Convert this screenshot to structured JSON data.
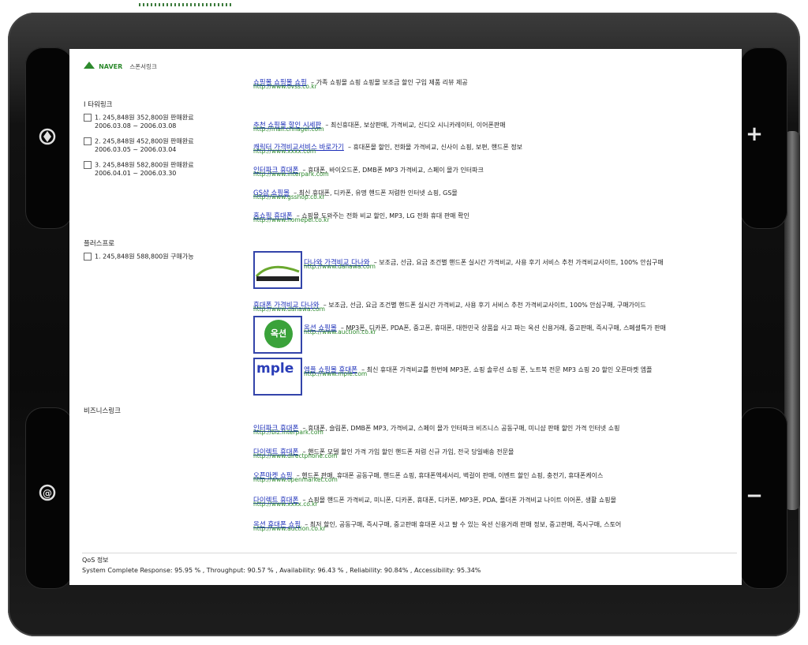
{
  "device": {
    "plus_label": "+",
    "minus_label": "−",
    "top_icon": "settings-rotate-icon",
    "bottom_icon": "refresh-icon"
  },
  "header": {
    "logo_text": "NAVER",
    "sponsor_label": "스폰서링크"
  },
  "top_ad": {
    "title": "쇼핑몰 쇼핑몰 쇼핑",
    "desc": "– 가족 쇼핑몰 쇼핑 쇼핑몰 보조금 할인 구입 제품 리뷰 제공",
    "url": "http://www.ovss.co.kr"
  },
  "sidebar": {
    "sections": [
      {
        "title": "Ⅰ 타워링크",
        "items": [
          {
            "line1": "1. 245,848원 352,800원 판매완료",
            "line2": "2006.03.08 ~ 2006.03.08"
          },
          {
            "line1": "2. 245,848원 452,800원 판매완료",
            "line2": "2006.03.05 ~ 2006.03.04"
          },
          {
            "line1": "3. 245,848원 582,800원 판매완료",
            "line2": "2006.04.01 ~ 2006.03.30"
          }
        ]
      },
      {
        "title": "플러스프로",
        "items": [
          {
            "line1": "1. 245,848원 588,800원 구매가능",
            "line2": ""
          }
        ]
      },
      {
        "title": "비즈니스링크",
        "items": []
      }
    ]
  },
  "ads_group1": [
    {
      "title": "추천 쇼핑몰 할인 시세판",
      "desc": "– 최신휴대폰, 보상판매, 가격비교, 신디오 시니카레이터, 이어폰판매",
      "url": "http://mall.chnagel.com"
    },
    {
      "title": "캐릭터 가격비교서비스 바로가기",
      "desc": "– 휴대폰몰 할인, 전화몰 가격비교, 신사이 쇼핑, 보편, 핸드폰 정보",
      "url": "http://www.xxxx.com"
    },
    {
      "title": "인터파크 휴대폰",
      "desc": "– 휴대폰, 바이오드폰, DMB폰 MP3 가격비교, 스페이 몰가 인터파크",
      "url": "http://www.interpark.com"
    },
    {
      "title": "GS샵 쇼핑몰",
      "desc": "– 최신 휴대폰, 디카폰, 유명 핸드폰 저렴한 인터넷 쇼핑, GS몰",
      "url": "http://www.gsshop.co.kr"
    },
    {
      "title": "홈쇼핑 휴대폰",
      "desc": "– 쇼핑몰 도와주는 전화 비교 할인, MP3, LG 전화 휴대 판매 확인",
      "url": "http://www.homepel.co.kr"
    }
  ],
  "ads_group2": [
    {
      "thumb": "danawa",
      "thumb_text": "",
      "title": "다나와 가격비교 다나와",
      "desc": "– 보조금, 선금, 요금 조건별 핸드폰 실시간 가격비교, 사용 후기 서비스 추천 가격비교사이트, 100% 안심구매",
      "url": "http://www.danawa.com"
    },
    {
      "thumb": "",
      "thumb_text": "",
      "title": "휴대폰 가격비교 다나와",
      "desc": "– 보조금, 선금, 요금 조건별 핸드폰 실시간 가격비교, 사용 후기 서비스 추천 가격비교사이트, 100% 안심구매, 구매가이드",
      "url": "http://www.danawa.com"
    },
    {
      "thumb": "auction",
      "thumb_text": "옥션",
      "title": "옥션 쇼핑몰",
      "desc": "– MP3폰, 디카폰, PDA폰, 중고폰, 휴대폰, 대한민국 상품을 사고 파는 옥션 신용거래, 중고판매, 즉시구매, 스페셜특가 판매",
      "url": "http://www.auction.co.kr"
    },
    {
      "thumb": "mple",
      "thumb_text": "mple",
      "title": "엠플 쇼핑몰 휴대폰",
      "desc": "– 최신 휴대폰 가격비교를 한번에 MP3폰, 쇼핑 솔루션 쇼핑 폰, 노트북 전문 MP3 쇼핑 20 할인 오픈마켓 엠플",
      "url": "http://www.mple.com"
    }
  ],
  "ads_group3": [
    {
      "title": "인터파크 휴대폰",
      "desc": "– 휴대폰, 슬림폰, DMB폰 MP3, 가격비교, 스페이 몰가 인터파크 비즈니스 공동구매, 미니샵 판매 할인 가격 인터넷 쇼핑",
      "url": "http://biz.interpark.com"
    },
    {
      "title": "다이렉트 휴대폰",
      "desc": "– 핸드폰 모델 할인 가격 가입 할인 핸드폰 저렴 신규 가입, 전국 당일배송 전문몰",
      "url": "http://www.directphone.com"
    },
    {
      "title": "오픈마켓 쇼핑",
      "desc": "– 핸드폰 판매, 휴대폰 공동구매, 핸드폰 쇼핑, 휴대폰액세서리, 벽걸이 판매, 이벤트 할인 쇼핑, 충전기, 휴대폰케이스",
      "url": "http://www.openmarket.com"
    },
    {
      "title": "다이렉트 휴대폰",
      "desc": "– 쇼핑몰 핸드폰 가격비교, 미니폰, 디카폰, 휴대폰, 디카폰, MP3폰, PDA, 폴더폰 가격비교 나이트 이어폰, 생활 쇼핑몰",
      "url": "http://www.xxxx.co.kr"
    },
    {
      "title": "옥션 휴대폰 쇼핑",
      "desc": "– 최저 할인, 공동구매, 즉시구매, 중고판매 휴대폰 사고 팔 수 있는 옥션 신용거래 판매 정보, 중고판매, 즉시구매, 스토어",
      "url": "http://www.auction.co.kr"
    }
  ],
  "qos": {
    "title": "QoS 정보",
    "line": "System Complete Response: 95.95 % ,  Throughput: 90.57 % ,  Availability: 96.43 % ,  Reliability: 90.84% ,  Accessibility: 95.34%"
  },
  "colors": {
    "link": "#1a2db8",
    "url": "#2d8a2d",
    "bezel": "#0d0d0d",
    "thumb_border": "#3344aa"
  }
}
